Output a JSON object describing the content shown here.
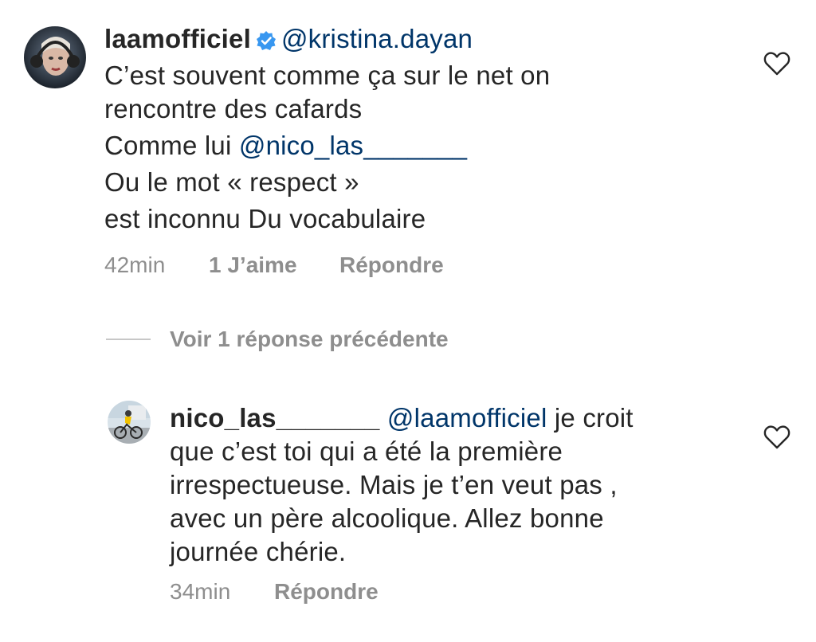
{
  "comments": [
    {
      "username": "laamofficiel",
      "verified": true,
      "mention": "@kristina.dayan",
      "lines": [
        "C’est souvent comme ça sur le net on",
        "rencontre des cafards"
      ],
      "line3_text": "Comme lui ",
      "line3_mention": "@nico_las_______",
      "lines_after": [
        "Ou le mot « respect »",
        "est inconnu Du vocabulaire"
      ],
      "time": "42min",
      "likes": "1 J’aime",
      "reply": "Répondre"
    },
    {
      "username": "nico_las_______",
      "mention": "@laamofficiel",
      "first_line_rest": " je croit",
      "lines": [
        "que c’est toi qui a été la première",
        "irrespectueuse. Mais je t’en veut pas ,",
        "avec un père alcoolique. Allez bonne",
        "journée chérie."
      ],
      "time": "34min",
      "reply": "Répondre"
    }
  ],
  "view_previous_replies": "Voir 1 réponse précédente",
  "icons": {
    "like": "heart-outline-icon",
    "verified": "verified-badge-icon"
  },
  "colors": {
    "text": "#262626",
    "secondary": "#8e8e8e",
    "mention": "#003569",
    "verified": "#3897f0"
  }
}
